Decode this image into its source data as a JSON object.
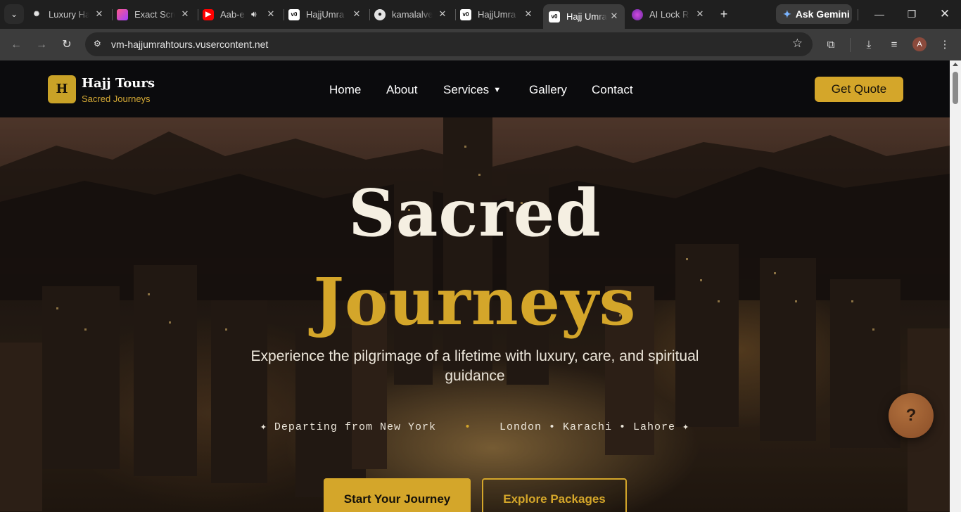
{
  "browser": {
    "tabs": [
      {
        "title": "Luxury Ha",
        "favicon": "openai-icon",
        "active": false
      },
      {
        "title": "Exact Scre",
        "favicon": "heart-app-icon",
        "active": false
      },
      {
        "title": "Aab-e",
        "favicon": "youtube-icon",
        "active": false,
        "audio": true
      },
      {
        "title": "HajjUmra",
        "favicon": "v0-icon",
        "active": false
      },
      {
        "title": "kamalalve",
        "favicon": "github-icon",
        "active": false
      },
      {
        "title": "HajjUmra",
        "favicon": "v0-icon",
        "active": false
      },
      {
        "title": "Hajj Umra",
        "favicon": "v0-icon",
        "active": true
      },
      {
        "title": "AI Lock R",
        "favicon": "lock-app-icon",
        "active": false
      }
    ],
    "gemini_label": "Ask Gemini",
    "url": "vm-hajjumrahtours.vusercontent.net",
    "profile_initial": "A"
  },
  "site": {
    "logo_letter": "H",
    "brand_name": "Hajj Tours",
    "brand_tagline": "Sacred Journeys",
    "nav": {
      "home": "Home",
      "about": "About",
      "services": "Services",
      "gallery": "Gallery",
      "contact": "Contact"
    },
    "cta": "Get Quote",
    "accent_color": "#d4a62a"
  },
  "hero": {
    "title_line1": "Sacred",
    "title_line2": "Journeys",
    "subtitle": "Experience the pilgrimage of a lifetime with luxury, care, and spiritual guidance",
    "departing_prefix": "✦ Departing from New York",
    "separator": "•",
    "departing_cities": "London • Karachi • Lahore ✦",
    "primary_button": "Start Your Journey",
    "secondary_button": "Explore Packages"
  },
  "help_button": "?"
}
